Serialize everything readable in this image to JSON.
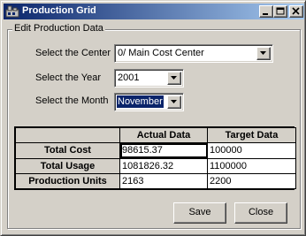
{
  "window": {
    "title": "Production Grid",
    "icon": "app-icon",
    "controls": {
      "minimize": "minimize-icon",
      "maximize": "maximize-icon",
      "close": "close-icon"
    }
  },
  "form": {
    "group_label": "Edit Production Data",
    "center": {
      "label": "Select the Center",
      "value": "0/ Main Cost Center"
    },
    "year": {
      "label": "Select the Year",
      "value": "2001"
    },
    "month": {
      "label": "Select the Month",
      "value": "November"
    }
  },
  "grid": {
    "columns": [
      "",
      "Actual Data",
      "Target Data"
    ],
    "rows": [
      {
        "label": "Total Cost",
        "actual": "98615.37",
        "target": "100000"
      },
      {
        "label": "Total Usage",
        "actual": "1081826.32",
        "target": "1100000"
      },
      {
        "label": "Production Units",
        "actual": "2163",
        "target": "2200"
      }
    ]
  },
  "buttons": {
    "save": "Save",
    "close": "Close"
  },
  "colors": {
    "titlebar_start": "#0a246a",
    "titlebar_end": "#a6caf0",
    "face": "#d4d0c8"
  }
}
